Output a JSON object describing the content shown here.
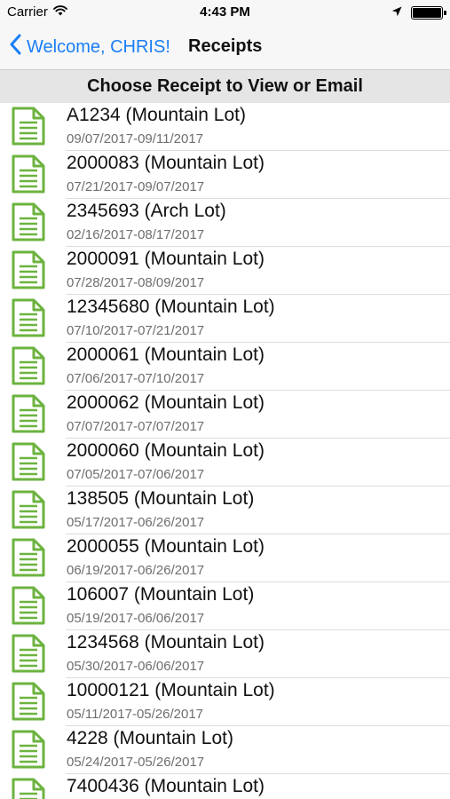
{
  "status_bar": {
    "carrier": "Carrier",
    "time": "4:43 PM",
    "battery_level": 1.0
  },
  "nav": {
    "back_label": "Welcome, CHRIS!",
    "title": "Receipts"
  },
  "section_header": "Choose Receipt to View or Email",
  "colors": {
    "accent": "#1a7ef5",
    "icon_green": "#6cb33f",
    "section_bg": "#e5e5e5"
  },
  "icons": {
    "receipt": "document-icon",
    "back": "chevron-left-icon",
    "wifi": "wifi-icon",
    "location": "location-arrow-icon",
    "battery": "battery-icon"
  },
  "receipts": [
    {
      "title": "A1234 (Mountain Lot)",
      "dates": "09/07/2017-09/11/2017"
    },
    {
      "title": "2000083 (Mountain Lot)",
      "dates": "07/21/2017-09/07/2017"
    },
    {
      "title": "2345693 (Arch Lot)",
      "dates": "02/16/2017-08/17/2017"
    },
    {
      "title": "2000091 (Mountain Lot)",
      "dates": "07/28/2017-08/09/2017"
    },
    {
      "title": "12345680 (Mountain Lot)",
      "dates": "07/10/2017-07/21/2017"
    },
    {
      "title": "2000061 (Mountain Lot)",
      "dates": "07/06/2017-07/10/2017"
    },
    {
      "title": "2000062 (Mountain Lot)",
      "dates": "07/07/2017-07/07/2017"
    },
    {
      "title": "2000060 (Mountain Lot)",
      "dates": "07/05/2017-07/06/2017"
    },
    {
      "title": "138505 (Mountain Lot)",
      "dates": "05/17/2017-06/26/2017"
    },
    {
      "title": "2000055 (Mountain Lot)",
      "dates": "06/19/2017-06/26/2017"
    },
    {
      "title": "106007 (Mountain Lot)",
      "dates": "05/19/2017-06/06/2017"
    },
    {
      "title": "1234568 (Mountain Lot)",
      "dates": "05/30/2017-06/06/2017"
    },
    {
      "title": "10000121 (Mountain Lot)",
      "dates": "05/11/2017-05/26/2017"
    },
    {
      "title": "4228 (Mountain Lot)",
      "dates": "05/24/2017-05/26/2017"
    },
    {
      "title": "7400436 (Mountain Lot)",
      "dates": ""
    }
  ]
}
